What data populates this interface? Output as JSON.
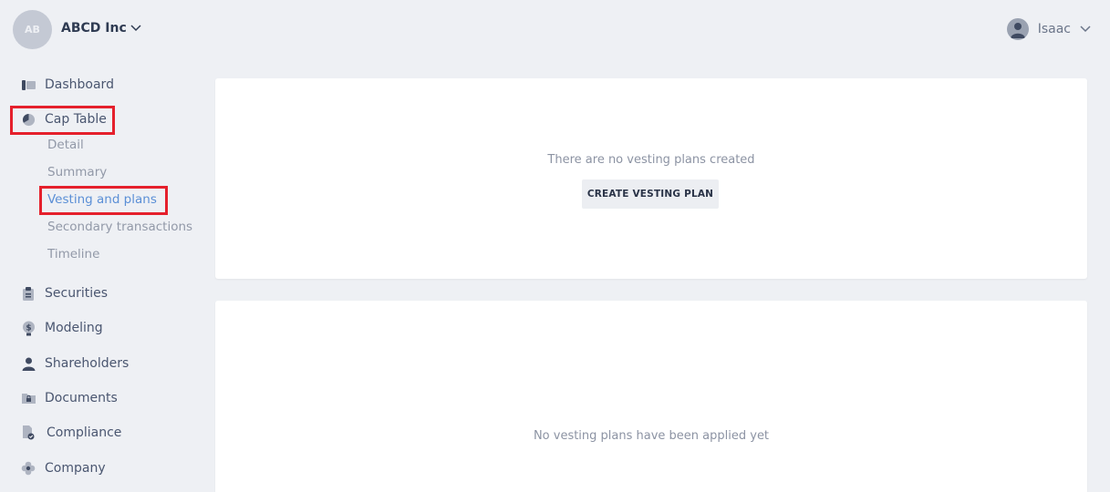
{
  "header": {
    "org_initials": "AB",
    "org_name": "ABCD Inc",
    "user_name": "Isaac"
  },
  "sidebar": {
    "items": [
      {
        "label": "Dashboard",
        "icon": "dashboard-icon"
      },
      {
        "label": "Cap Table",
        "icon": "pie-chart-icon"
      },
      {
        "label": "Securities",
        "icon": "clipboard-icon"
      },
      {
        "label": "Modeling",
        "icon": "dollar-icon"
      },
      {
        "label": "Shareholders",
        "icon": "person-icon"
      },
      {
        "label": "Documents",
        "icon": "folder-lock-icon"
      },
      {
        "label": "Compliance",
        "icon": "document-check-icon"
      },
      {
        "label": "Company",
        "icon": "flower-icon"
      }
    ],
    "cap_table_sub": [
      {
        "label": "Detail"
      },
      {
        "label": "Summary"
      },
      {
        "label": "Vesting and plans"
      },
      {
        "label": "Secondary transactions"
      },
      {
        "label": "Timeline"
      }
    ]
  },
  "main": {
    "plans_card": {
      "empty_text": "There are no vesting plans created",
      "button_label": "CREATE VESTING PLAN"
    },
    "applied_card": {
      "empty_text": "No vesting plans have been applied yet"
    }
  },
  "colors": {
    "background": "#eef0f4",
    "active_link": "#5b8fd6",
    "highlight": "#e5202c"
  }
}
